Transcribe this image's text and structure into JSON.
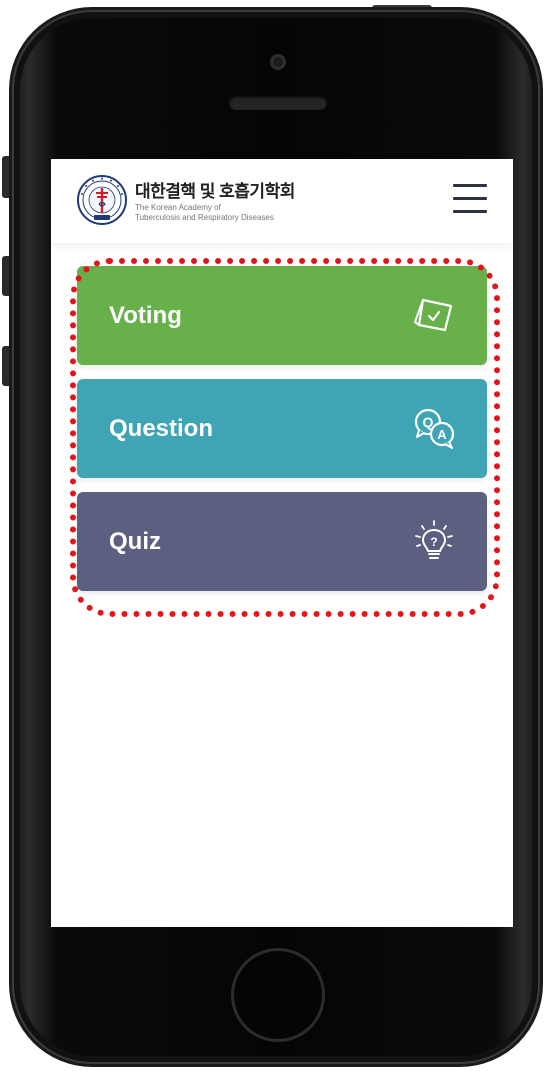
{
  "header": {
    "org_name_ko": "대한결핵 및 호흡기학회",
    "org_name_en_line1": "The Korean Academy of",
    "org_name_en_line2": "Tuberculosis and Respiratory Diseases"
  },
  "menu": [
    {
      "label": "Voting",
      "icon": "voting-icon",
      "color": "#67b04a"
    },
    {
      "label": "Question",
      "icon": "qa-chat-icon",
      "color": "#3fa5b4"
    },
    {
      "label": "Quiz",
      "icon": "lightbulb-question-icon",
      "color": "#5b6080"
    }
  ],
  "colors": {
    "highlight": "#e3151b",
    "hamburger": "#2d3340"
  }
}
